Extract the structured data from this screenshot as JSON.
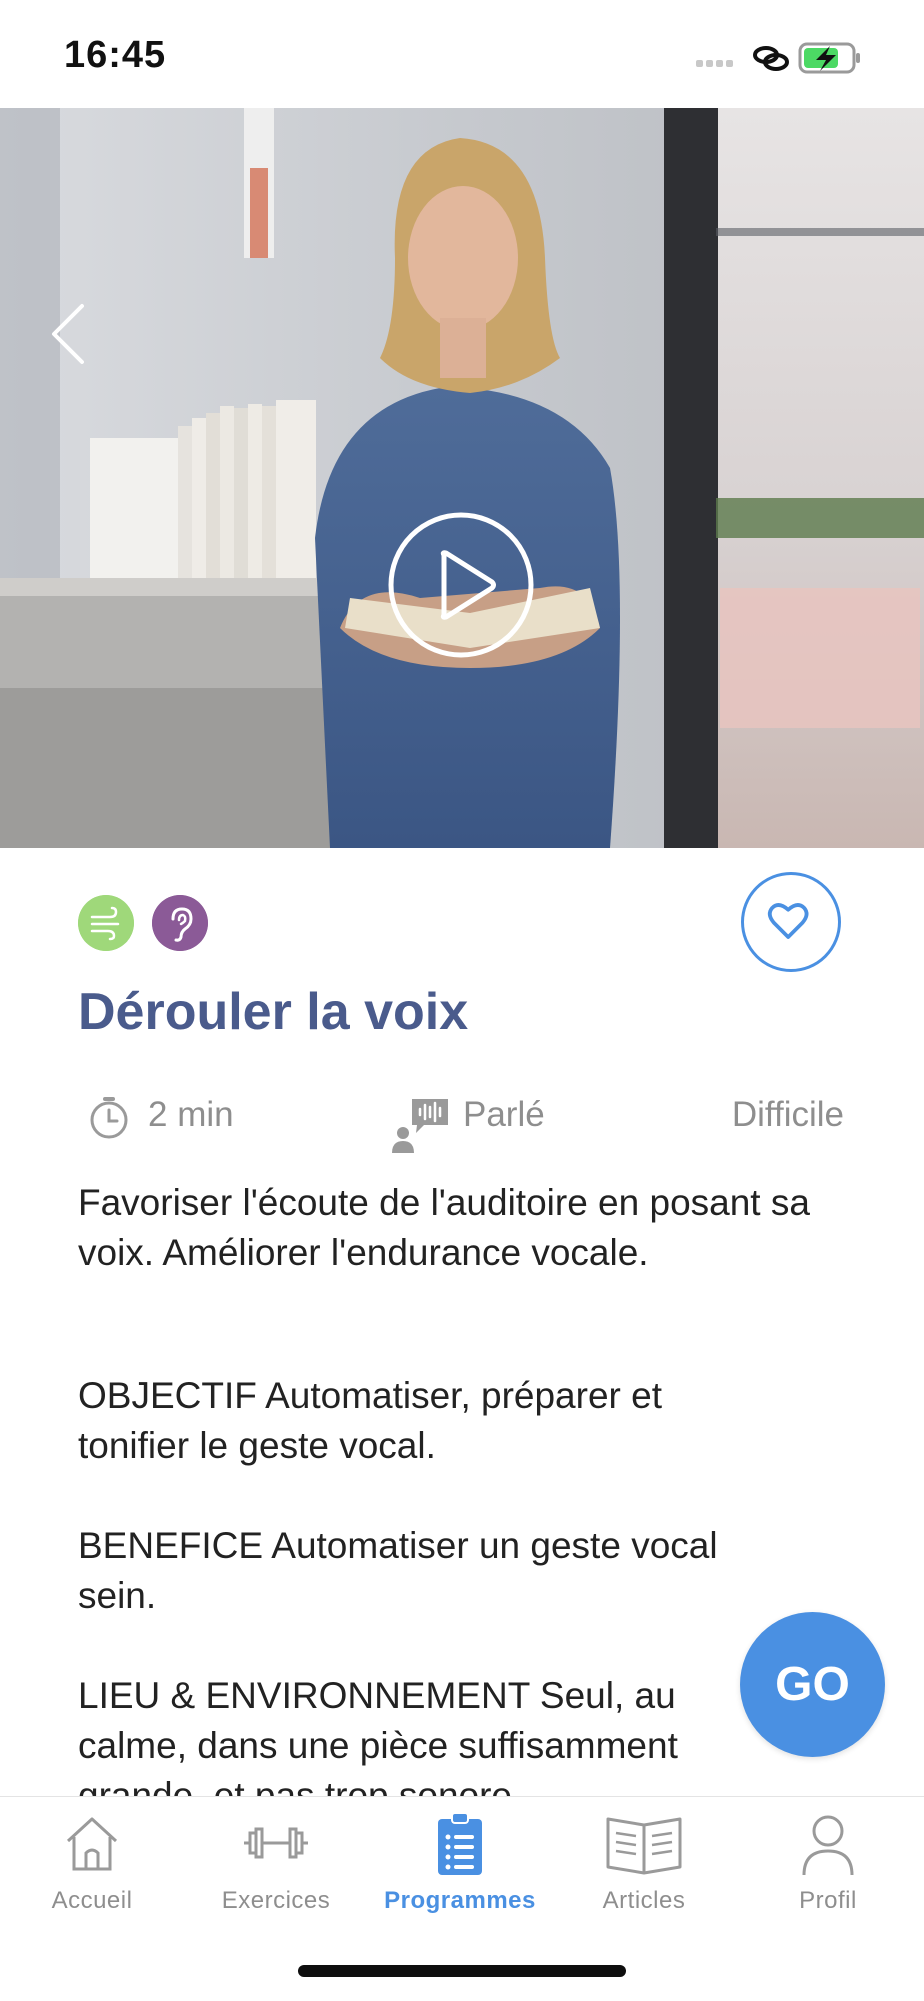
{
  "status_bar": {
    "time": "16:45"
  },
  "exercise": {
    "title": "Dérouler la voix",
    "duration": "2 min",
    "type": "Parlé",
    "level": "Difficile",
    "summary": "Favoriser l'écoute de l'auditoire en posant sa voix. Améliorer l'endurance vocale.",
    "sections": [
      {
        "text": "OBJECTIF Automatiser, préparer et tonifier le geste vocal."
      },
      {
        "text": "BENEFICE Automatiser un geste vocal sein."
      },
      {
        "text": "LIEU & ENVIRONNEMENT Seul, au calme, dans une pièce suffisamment grande, et pas trop sonore."
      }
    ],
    "go_label": "GO"
  },
  "colors": {
    "accent": "#4a90e2",
    "title": "#4a5b8c",
    "tag_breath": "#9fd87a",
    "tag_ear": "#8b5a97"
  },
  "tabs": [
    {
      "label": "Accueil",
      "icon": "home-icon"
    },
    {
      "label": "Exercices",
      "icon": "dumbbell-icon"
    },
    {
      "label": "Programmes",
      "icon": "clipboard-list-icon",
      "active": true
    },
    {
      "label": "Articles",
      "icon": "open-book-icon"
    },
    {
      "label": "Profil",
      "icon": "user-icon"
    }
  ]
}
